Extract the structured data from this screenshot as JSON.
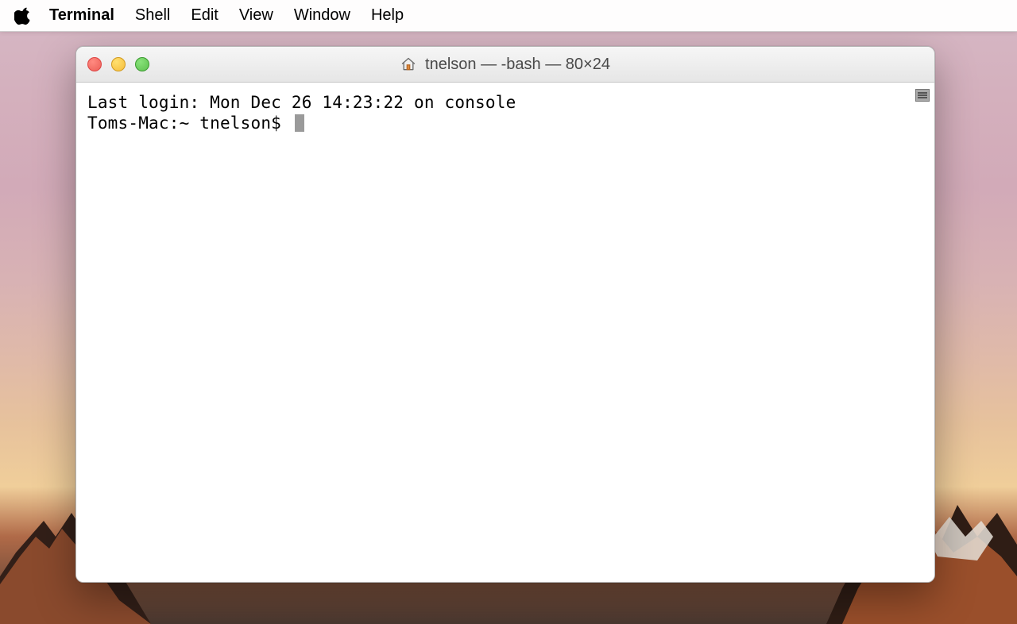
{
  "menubar": {
    "app_name": "Terminal",
    "items": [
      "Shell",
      "Edit",
      "View",
      "Window",
      "Help"
    ]
  },
  "window": {
    "title": "tnelson — -bash — 80×24"
  },
  "terminal": {
    "last_login": "Last login: Mon Dec 26 14:23:22 on console",
    "prompt": "Toms-Mac:~ tnelson$ "
  }
}
